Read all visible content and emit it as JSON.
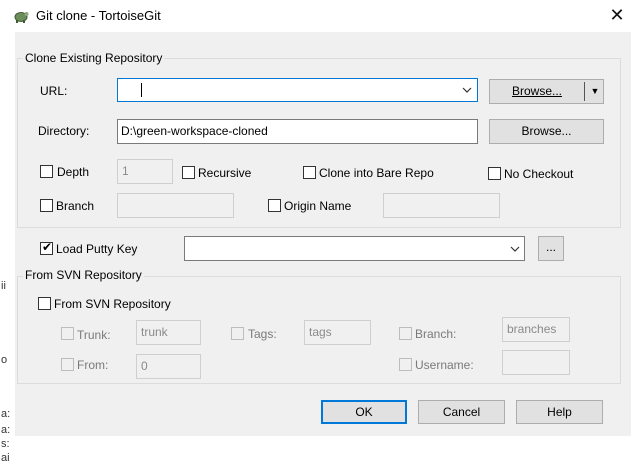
{
  "window": {
    "title": "Git clone - TortoiseGit",
    "close_label": "✕",
    "icon": "tortoisegit-icon"
  },
  "clone_group": {
    "legend": "Clone Existing Repository",
    "url_label": "URL:",
    "url_value": "",
    "browse_url_label": "Browse...",
    "browse_url_arrow": "▼",
    "directory_label": "Directory:",
    "directory_value": "D:\\green-workspace-cloned",
    "browse_dir_label": "Browse...",
    "depth_label": "Depth",
    "depth_value": "1",
    "recursive_label": "Recursive",
    "bare_label": "Clone into Bare Repo",
    "no_checkout_label": "No Checkout",
    "branch_label": "Branch",
    "branch_value": "",
    "origin_label": "Origin Name",
    "origin_value": ""
  },
  "putty": {
    "label": "Load Putty Key",
    "checked": true,
    "value": "",
    "browse_label": "..."
  },
  "svn_group": {
    "legend": "From SVN Repository",
    "checkbox_label": "From SVN Repository",
    "trunk_label": "Trunk:",
    "trunk_value": "trunk",
    "tags_label": "Tags:",
    "tags_value": "tags",
    "branch_label": "Branch:",
    "branch_value": "branches",
    "from_label": "From:",
    "from_value": "0",
    "username_label": "Username:",
    "username_value": ""
  },
  "buttons": {
    "ok": "OK",
    "cancel": "Cancel",
    "help": "Help"
  },
  "background_strip": [
    "ii",
    "o",
    "a:",
    "a:",
    "s:",
    "ai"
  ],
  "colors": {
    "accent": "#0078d7",
    "dialog_bg": "#f0f0f0"
  }
}
